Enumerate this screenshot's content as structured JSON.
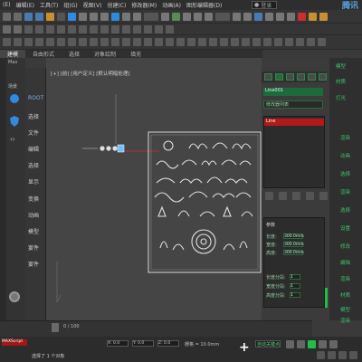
{
  "menubar": {
    "items": [
      "(E)",
      "编辑(E)",
      "工具(T)",
      "组(G)",
      "视图(V)",
      "创建(C)",
      "修改器(M)",
      "动画(A)",
      "图形编辑器(D)"
    ],
    "search_label": "登录",
    "brand": "腾讯"
  },
  "ribbon": {
    "tabs": [
      "建模",
      "自由形式",
      "选择",
      "对象绘制",
      "填充"
    ]
  },
  "left_toolbar": {
    "labels": [
      "Max",
      "场景"
    ]
  },
  "scene_panel": {
    "items": [
      "ROOT",
      "选择",
      "文件",
      "编辑",
      "选择",
      "显示",
      "变换",
      "动画",
      "模型",
      "宴件",
      "宴件"
    ]
  },
  "viewport": {
    "label": "[+] [前] [用户定义] [默认明暗处理]"
  },
  "command_panel": {
    "object_name": "Line001",
    "modifier_list_label": "修改器列表",
    "stack_selected": "Line",
    "params_title": "参数",
    "params": [
      {
        "label": "长度:",
        "value": "300.0mm"
      },
      {
        "label": "宽度:",
        "value": "300.0mm"
      },
      {
        "label": "高度:",
        "value": "300.0mm"
      }
    ],
    "segs": [
      {
        "label": "长度分段:",
        "value": "1"
      },
      {
        "label": "宽度分段:",
        "value": "1"
      },
      {
        "label": "高度分段:",
        "value": "1"
      }
    ]
  },
  "right_column": {
    "items": [
      "模型",
      "材质",
      "灯光",
      "渲染",
      "动画",
      "选择",
      "渲染",
      "选择",
      "设置",
      "修改",
      "编辑",
      "渲染",
      "材质",
      "模型",
      "渲染",
      "渲染设置"
    ]
  },
  "timeline": {
    "position": "0 / 100"
  },
  "bottombar": {
    "red_label": "MAXScript",
    "status": "选择了 1 个对象",
    "grid_label": "栅格 = 10.0mm",
    "auto_key": "自动关键点",
    "coords": [
      "X: 0.0",
      "Y: 0.0",
      "Z: 0.0"
    ]
  },
  "colors": {
    "accent_green": "#1fbf4a",
    "selection_red": "#b01a1a",
    "viewport_bg": "#454545"
  }
}
